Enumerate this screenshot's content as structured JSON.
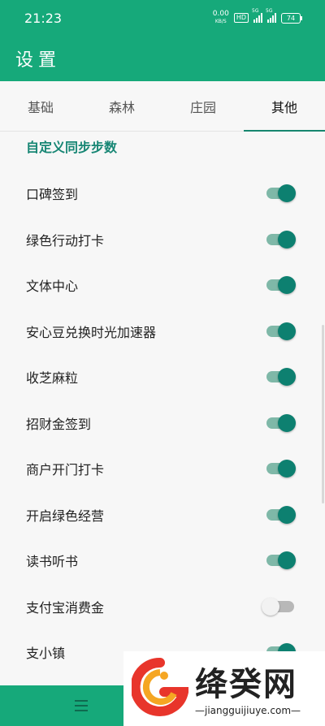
{
  "status": {
    "time": "21:23",
    "speed_value": "0.00",
    "speed_unit": "KB/S",
    "hd": "HD",
    "sig1": "5G",
    "sig2": "5G",
    "battery": "74"
  },
  "appbar": {
    "title": "设置"
  },
  "tabs": [
    {
      "label": "基础"
    },
    {
      "label": "森林"
    },
    {
      "label": "庄园"
    },
    {
      "label": "其他"
    }
  ],
  "active_tab": 3,
  "section": {
    "title": "自定义同步步数"
  },
  "settings": [
    {
      "label": "口碑签到",
      "on": true
    },
    {
      "label": "绿色行动打卡",
      "on": true
    },
    {
      "label": "文体中心",
      "on": true
    },
    {
      "label": "安心豆兑换时光加速器",
      "on": true
    },
    {
      "label": "收芝麻粒",
      "on": true
    },
    {
      "label": "招财金签到",
      "on": true
    },
    {
      "label": "商户开门打卡",
      "on": true
    },
    {
      "label": "开启绿色经营",
      "on": true
    },
    {
      "label": "读书听书",
      "on": true
    },
    {
      "label": "支付宝消费金",
      "on": false
    },
    {
      "label": "支小镇",
      "on": true
    }
  ],
  "watermark": {
    "brand_cn": "绛癸网",
    "brand_url": "—jiangguijiuye.com—"
  },
  "colors": {
    "primary": "#16a97a",
    "accent": "#0d8070",
    "accent_track": "#7fb8a8",
    "section_text": "#178674"
  }
}
